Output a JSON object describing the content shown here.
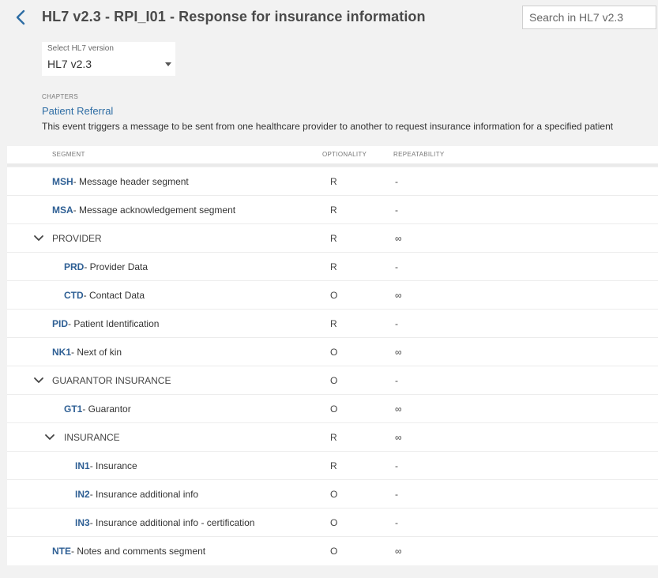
{
  "header": {
    "title": "HL7 v2.3 - RPI_I01 - Response for insurance information",
    "search_placeholder": "Search in HL7 v2.3",
    "back_icon": "chevron-left-icon"
  },
  "version_select": {
    "label": "Select HL7 version",
    "value": "HL7 v2.3"
  },
  "chapter": {
    "section_label": "CHAPTERS",
    "name": "Patient Referral",
    "description": "This event triggers a message to be sent from one healthcare provider to another to request insurance information for a specified patient"
  },
  "table": {
    "columns": {
      "segment": "SEGMENT",
      "optionality": "OPTIONALITY",
      "repeatability": "REPEATABILITY"
    },
    "rows": [
      {
        "code": "MSH",
        "desc": " - Message header segment",
        "opt": "R",
        "rep": "-"
      },
      {
        "code": "MSA",
        "desc": " - Message acknowledgement segment",
        "opt": "R",
        "rep": "-"
      },
      {
        "group": "PROVIDER",
        "opt": "R",
        "rep": "∞"
      },
      {
        "code": "PRD",
        "desc": " - Provider Data",
        "opt": "R",
        "rep": "-"
      },
      {
        "code": "CTD",
        "desc": " - Contact Data",
        "opt": "O",
        "rep": "∞"
      },
      {
        "code": "PID",
        "desc": " - Patient Identification",
        "opt": "R",
        "rep": "-"
      },
      {
        "code": "NK1",
        "desc": " - Next of kin",
        "opt": "O",
        "rep": "∞"
      },
      {
        "group": "GUARANTOR INSURANCE",
        "opt": "O",
        "rep": "-"
      },
      {
        "code": "GT1",
        "desc": " - Guarantor",
        "opt": "O",
        "rep": "∞"
      },
      {
        "group": "INSURANCE",
        "opt": "R",
        "rep": "∞"
      },
      {
        "code": "IN1",
        "desc": " - Insurance",
        "opt": "R",
        "rep": "-"
      },
      {
        "code": "IN2",
        "desc": " - Insurance additional info",
        "opt": "O",
        "rep": "-"
      },
      {
        "code": "IN3",
        "desc": " - Insurance additional info - certification",
        "opt": "O",
        "rep": "-"
      },
      {
        "code": "NTE",
        "desc": " - Notes and comments segment",
        "opt": "O",
        "rep": "∞"
      }
    ]
  },
  "colors": {
    "link": "#2e6da4",
    "segment_code": "#2e5f94",
    "background": "#f2f2f2"
  }
}
